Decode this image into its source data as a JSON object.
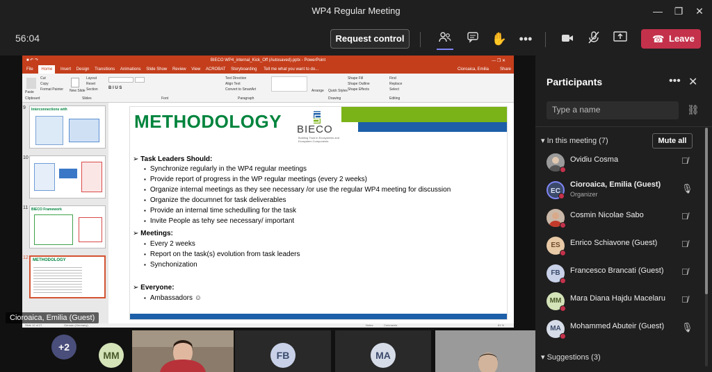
{
  "window": {
    "title": "WP4 Regular Meeting",
    "minimize": "—",
    "restore": "❐",
    "close": "✕"
  },
  "meeting": {
    "timer": "56:04",
    "request_control": "Request control",
    "leave": "Leave"
  },
  "powerpoint": {
    "file_title": "BIECO WP4_internal_Kick_Off (Autosaved).pptx - PowerPoint",
    "user": "Cioroaica, Emilia",
    "share": "Share",
    "tell_me": "Tell me what you want to do...",
    "menu": [
      "File",
      "Home",
      "Insert",
      "Design",
      "Transitions",
      "Animations",
      "Slide Show",
      "Review",
      "View",
      "ACROBAT",
      "Storyboarding"
    ],
    "ribbon_groups": [
      "Clipboard",
      "Slides",
      "Font",
      "Paragraph",
      "Drawing",
      "Editing"
    ],
    "ribbon_items": {
      "paste": "Paste",
      "cut": "Cut",
      "copy": "Copy",
      "format_painter": "Format Painter",
      "new_slide": "New Slide",
      "layout": "Layout",
      "reset": "Reset",
      "section": "Section",
      "text_direction": "Text Direction",
      "align_text": "Align Text",
      "smartart": "Convert to SmartArt",
      "arrange": "Arrange",
      "quick_styles": "Quick Styles",
      "shape_fill": "Shape Fill",
      "shape_outline": "Shape Outline",
      "shape_effects": "Shape Effects",
      "find": "Find",
      "replace": "Replace",
      "select": "Select"
    },
    "slide_numbers": [
      "9",
      "10",
      "11",
      "12"
    ],
    "thumb_title_9": "Interconnections with",
    "thumb_title_11": "BIECO Framework",
    "thumb_title_12": "METHODOLOGY",
    "status": {
      "slide": "Slide 12 of 27",
      "lang": "German (Germany)",
      "notes": "Notes",
      "comments": "Comments",
      "zoom": "81 %"
    }
  },
  "slide": {
    "heading": "METHODOLOGY",
    "logo_text": "BIECO",
    "logo_sub": "Building Trust in Ecosystems and Ecosystem Components",
    "sections": [
      {
        "title": "Task Leaders Should:",
        "bullets": [
          "Synchronize regularly in the WP4 regular meetings",
          "Provide report of progress in the WP regular meetings (every 2 weeks)",
          "Organize internal meetings as they see necessary /or use the regular WP4 meeting for discussion",
          "Organize the documnet for task deliverables",
          "Provide an internal time schedulling for the task",
          "Invite People as tehy see necessary/ important"
        ]
      },
      {
        "title": "Meetings:",
        "bullets": [
          "Every 2 weeks",
          "Report on the task(s) evolution from task leaders",
          "Synchonization"
        ]
      },
      {
        "title": "Everyone:",
        "bullets": [
          "Ambassadors ☺"
        ]
      }
    ]
  },
  "sharer_name": "Cioroaica, Emilia (Guest)",
  "participants_panel": {
    "title": "Participants",
    "search_placeholder": "Type a name",
    "in_meeting_label": "In this meeting (7)",
    "mute_all": "Mute all",
    "suggestions_label": "Suggestions (3)",
    "people": [
      {
        "name": "Ovidiu Cosma",
        "initials": "",
        "role": "",
        "color": "#8a8a8a",
        "mic": "muted"
      },
      {
        "name": "Cioroaica, Emilia (Guest)",
        "initials": "EC",
        "role": "Organizer",
        "color": "#3b4a6b",
        "mic": "on"
      },
      {
        "name": "Cosmin Nicolae Sabo",
        "initials": "",
        "role": "",
        "color": "#b0452f",
        "mic": "muted"
      },
      {
        "name": "Enrico Schiavone (Guest)",
        "initials": "ES",
        "role": "",
        "color": "#e8c9a6",
        "mic": "muted"
      },
      {
        "name": "Francesco Brancati (Guest)",
        "initials": "FB",
        "role": "",
        "color": "#c8d1e8",
        "mic": "muted"
      },
      {
        "name": "Mara Diana Hajdu Macelaru",
        "initials": "MM",
        "role": "",
        "color": "#d4e3b8",
        "mic": "muted"
      },
      {
        "name": "Mohammed Abuteir (Guest)",
        "initials": "MA",
        "role": "",
        "color": "#d6dde8",
        "mic": "on"
      }
    ]
  },
  "gallery": {
    "overflow": "+2",
    "tiles": [
      "MM",
      "FB",
      "MA"
    ]
  },
  "colors": {
    "leave": "#c4314b",
    "ppt_accent": "#c43e1c",
    "slide_heading": "#00843d",
    "stripe_green": "#7ab317",
    "stripe_blue": "#1d5fa8"
  }
}
